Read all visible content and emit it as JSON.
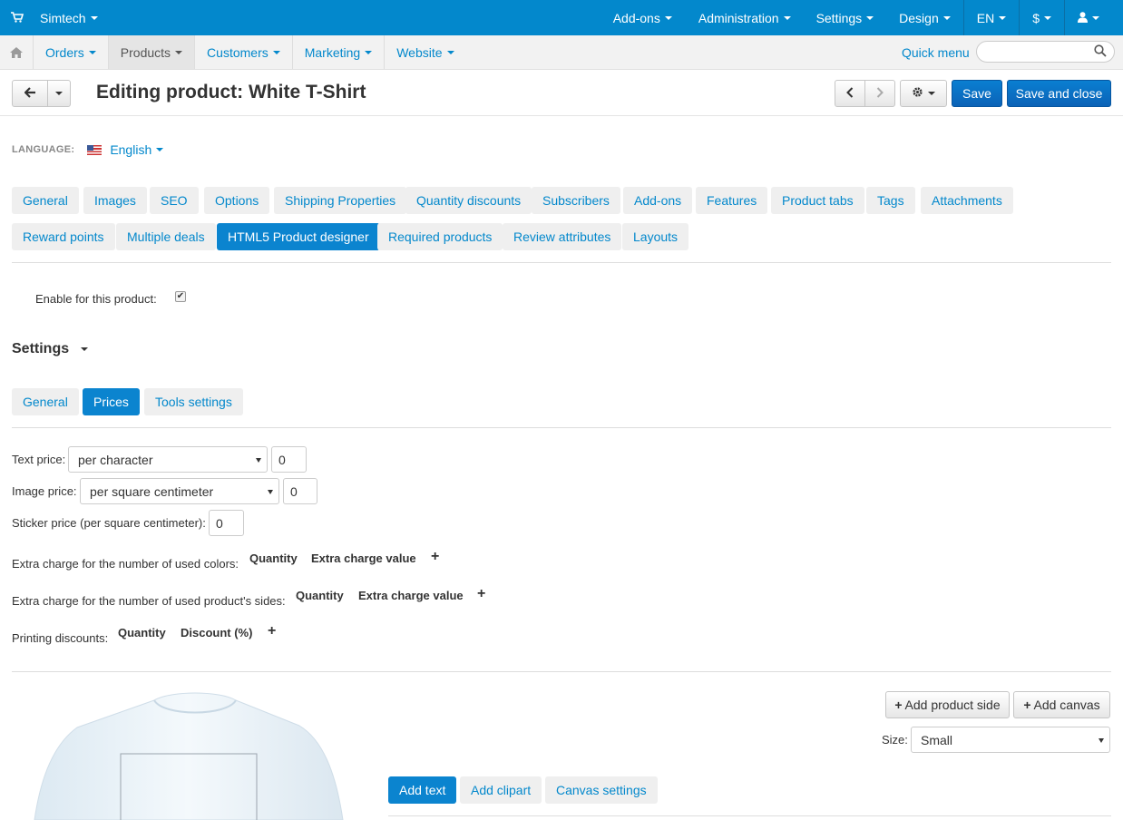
{
  "topbar": {
    "store": "Simtech",
    "menu": [
      "Add-ons",
      "Administration",
      "Settings",
      "Design",
      "EN",
      "$"
    ]
  },
  "nav": {
    "items": [
      "Orders",
      "Products",
      "Customers",
      "Marketing",
      "Website"
    ],
    "quick_menu": "Quick menu",
    "search_placeholder": ""
  },
  "header": {
    "title": "Editing product: White T-Shirt",
    "save": "Save",
    "save_close": "Save and close"
  },
  "language": {
    "label": "LANGUAGE:",
    "value": "English"
  },
  "tabs": {
    "row1": [
      "General",
      "Images",
      "SEO",
      "Options",
      "Shipping Properties",
      "Quantity discounts",
      "Subscribers",
      "Add-ons",
      "Features",
      "Product tabs",
      "Tags",
      "Attachments"
    ],
    "row2": [
      "Reward points",
      "Multiple deals",
      "HTML5 Product designer",
      "Required products",
      "Review attributes",
      "Layouts"
    ]
  },
  "enable": {
    "label": "Enable for this product:",
    "checked": true
  },
  "settings": {
    "title": "Settings",
    "subtabs": [
      "General",
      "Prices",
      "Tools settings"
    ]
  },
  "prices": {
    "text_price_label": "Text price:",
    "text_price_select": "per character",
    "text_price_value": "0",
    "image_price_label": "Image price:",
    "image_price_select": "per square centimeter",
    "image_price_value": "0",
    "sticker_price_label": "Sticker price (per square centimeter):",
    "sticker_price_value": "0",
    "colors_label": "Extra charge for the number of used colors:",
    "colors_col1": "Quantity",
    "colors_col2": "Extra charge value",
    "sides_label": "Extra charge for the number of used product's sides:",
    "sides_col1": "Quantity",
    "sides_col2": "Extra charge value",
    "discounts_label": "Printing discounts:",
    "discounts_col1": "Quantity",
    "discounts_col2": "Discount (%)"
  },
  "designer": {
    "add_side": "Add product side",
    "add_canvas": "Add canvas",
    "size_label": "Size:",
    "size_value": "Small",
    "tabs": [
      "Add text",
      "Add clipart",
      "Canvas settings"
    ]
  },
  "colors": {
    "primary": "#0388cc",
    "save": "#0b63b7"
  }
}
